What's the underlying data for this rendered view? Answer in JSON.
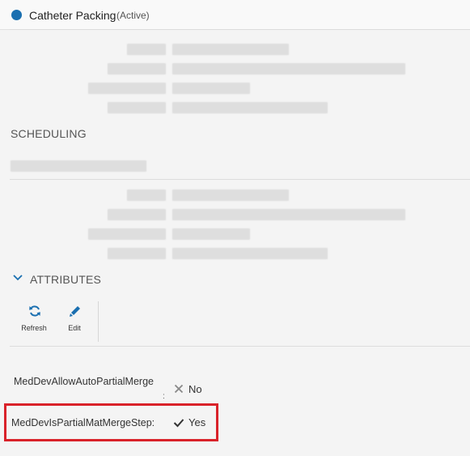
{
  "header": {
    "entity_name": "Catheter Packing",
    "entity_status": "(Active)",
    "status_color": "#1a6fb0",
    "status_icon": "status-dot-icon"
  },
  "sections": {
    "scheduling_label": "SCHEDULING",
    "attributes_label": "ATTRIBUTES"
  },
  "toolbar": {
    "refresh_label": "Refresh",
    "refresh_icon": "refresh-icon",
    "edit_label": "Edit",
    "edit_icon": "pencil-icon"
  },
  "attributes": [
    {
      "name": "MedDevAllowAutoPartialMerge",
      "value": "No",
      "icon": "x-icon"
    },
    {
      "name": "MedDevIsPartialMatMergeStep:",
      "value": "Yes",
      "icon": "check-icon"
    }
  ],
  "colors": {
    "accent": "#1a6fb0",
    "highlight": "#d9222a"
  }
}
